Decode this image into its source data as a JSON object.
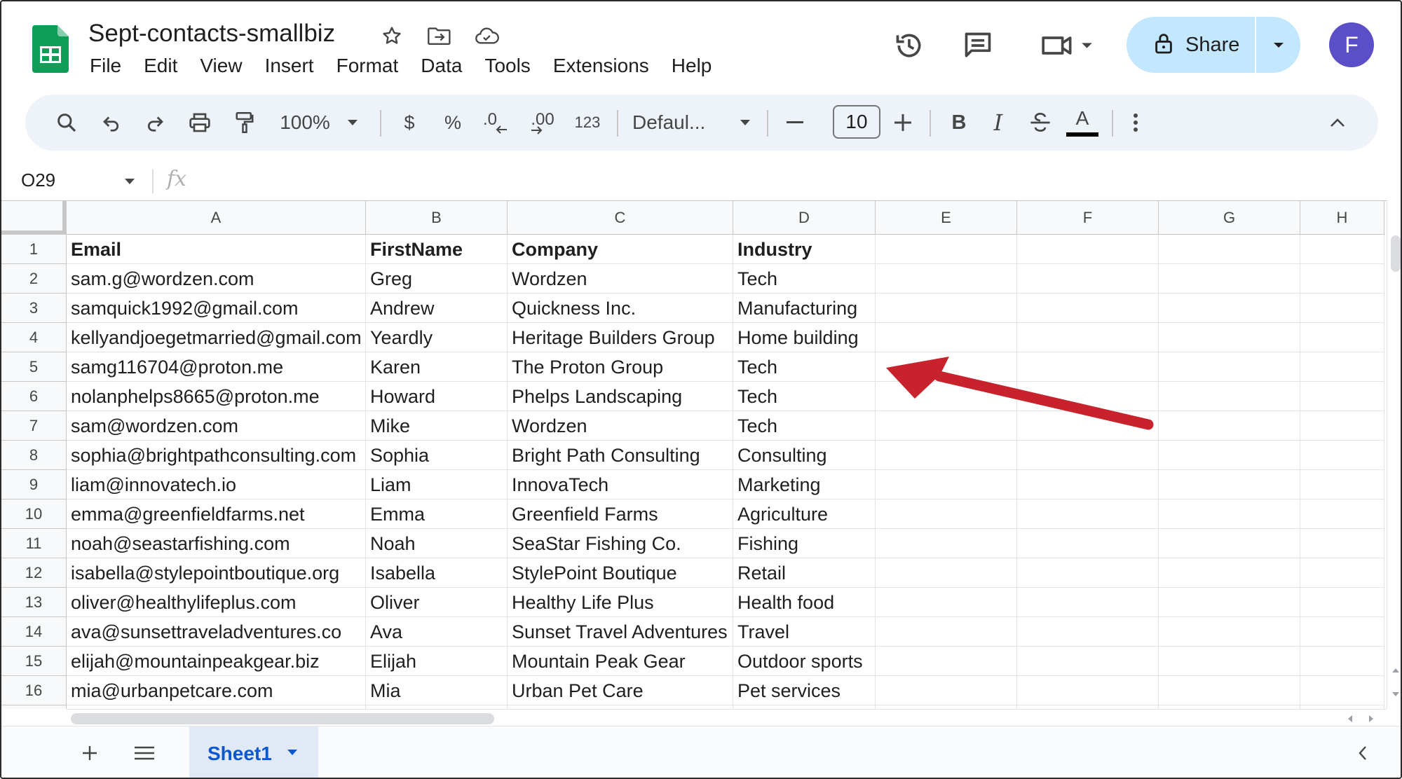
{
  "doc": {
    "title": "Sept-contacts-smallbiz",
    "title_icons": [
      "star-icon",
      "move-to-folder-icon",
      "cloud-saved-icon"
    ]
  },
  "menu": [
    "File",
    "Edit",
    "View",
    "Insert",
    "Format",
    "Data",
    "Tools",
    "Extensions",
    "Help"
  ],
  "header_actions": {
    "history_icon": "version-history-icon",
    "comments_icon": "comments-icon",
    "meet_icon": "video-call-icon",
    "share_label": "Share",
    "avatar_initial": "F"
  },
  "toolbar": {
    "zoom": "100%",
    "currency": "$",
    "percent": "%",
    "dec_decrease": ".0",
    "dec_increase": ".00",
    "number_format": "123",
    "font": "Defaul...",
    "font_size": "10",
    "bold": "B",
    "italic": "I",
    "text_color": "A"
  },
  "formula_bar": {
    "name_box": "O29",
    "fx": "fx"
  },
  "columns": [
    "A",
    "B",
    "C",
    "D",
    "E",
    "F",
    "G",
    "H"
  ],
  "rows": [
    [
      "Email",
      "FirstName",
      "Company",
      "Industry"
    ],
    [
      "sam.g@wordzen.com",
      "Greg",
      "Wordzen",
      "Tech"
    ],
    [
      "samquick1992@gmail.com",
      "Andrew",
      "Quickness Inc.",
      "Manufacturing"
    ],
    [
      "kellyandjoegetmarried@gmail.com",
      "Yeardly",
      "Heritage Builders Group",
      "Home building"
    ],
    [
      "samg116704@proton.me",
      "Karen",
      "The Proton Group",
      "Tech"
    ],
    [
      "nolanphelps8665@proton.me",
      "Howard",
      "Phelps Landscaping",
      "Tech"
    ],
    [
      "sam@wordzen.com",
      "Mike",
      "Wordzen",
      "Tech"
    ],
    [
      "sophia@brightpathconsulting.com",
      "Sophia",
      "Bright Path Consulting",
      "Consulting"
    ],
    [
      "liam@innovatech.io",
      "Liam",
      "InnovaTech",
      "Marketing"
    ],
    [
      "emma@greenfieldfarms.net",
      "Emma",
      "Greenfield Farms",
      "Agriculture"
    ],
    [
      "noah@seastarfishing.com",
      "Noah",
      "SeaStar Fishing Co.",
      "Fishing"
    ],
    [
      "isabella@stylepointboutique.org",
      "Isabella",
      "StylePoint Boutique",
      "Retail"
    ],
    [
      "oliver@healthylifeplus.com",
      "Oliver",
      "Healthy Life Plus",
      "Health food"
    ],
    [
      "ava@sunsettraveladventures.co",
      "Ava",
      "Sunset Travel Adventures",
      "Travel"
    ],
    [
      "elijah@mountainpeakgear.biz",
      "Elijah",
      "Mountain Peak Gear",
      "Outdoor sports"
    ],
    [
      "mia@urbanpetcare.com",
      "Mia",
      "Urban Pet Care",
      "Pet services"
    ]
  ],
  "sheets": [
    {
      "name": "Sheet1",
      "active": true
    }
  ],
  "annotation": {
    "type": "red-arrow",
    "color": "#c8232c"
  },
  "colors": {
    "share_bg": "#c2e7ff",
    "toolbar_bg": "#eef2f9",
    "avatar": "#5b4fc7",
    "sheet_tab_text": "#0b57d0",
    "sheets_green": "#0f9d58"
  }
}
